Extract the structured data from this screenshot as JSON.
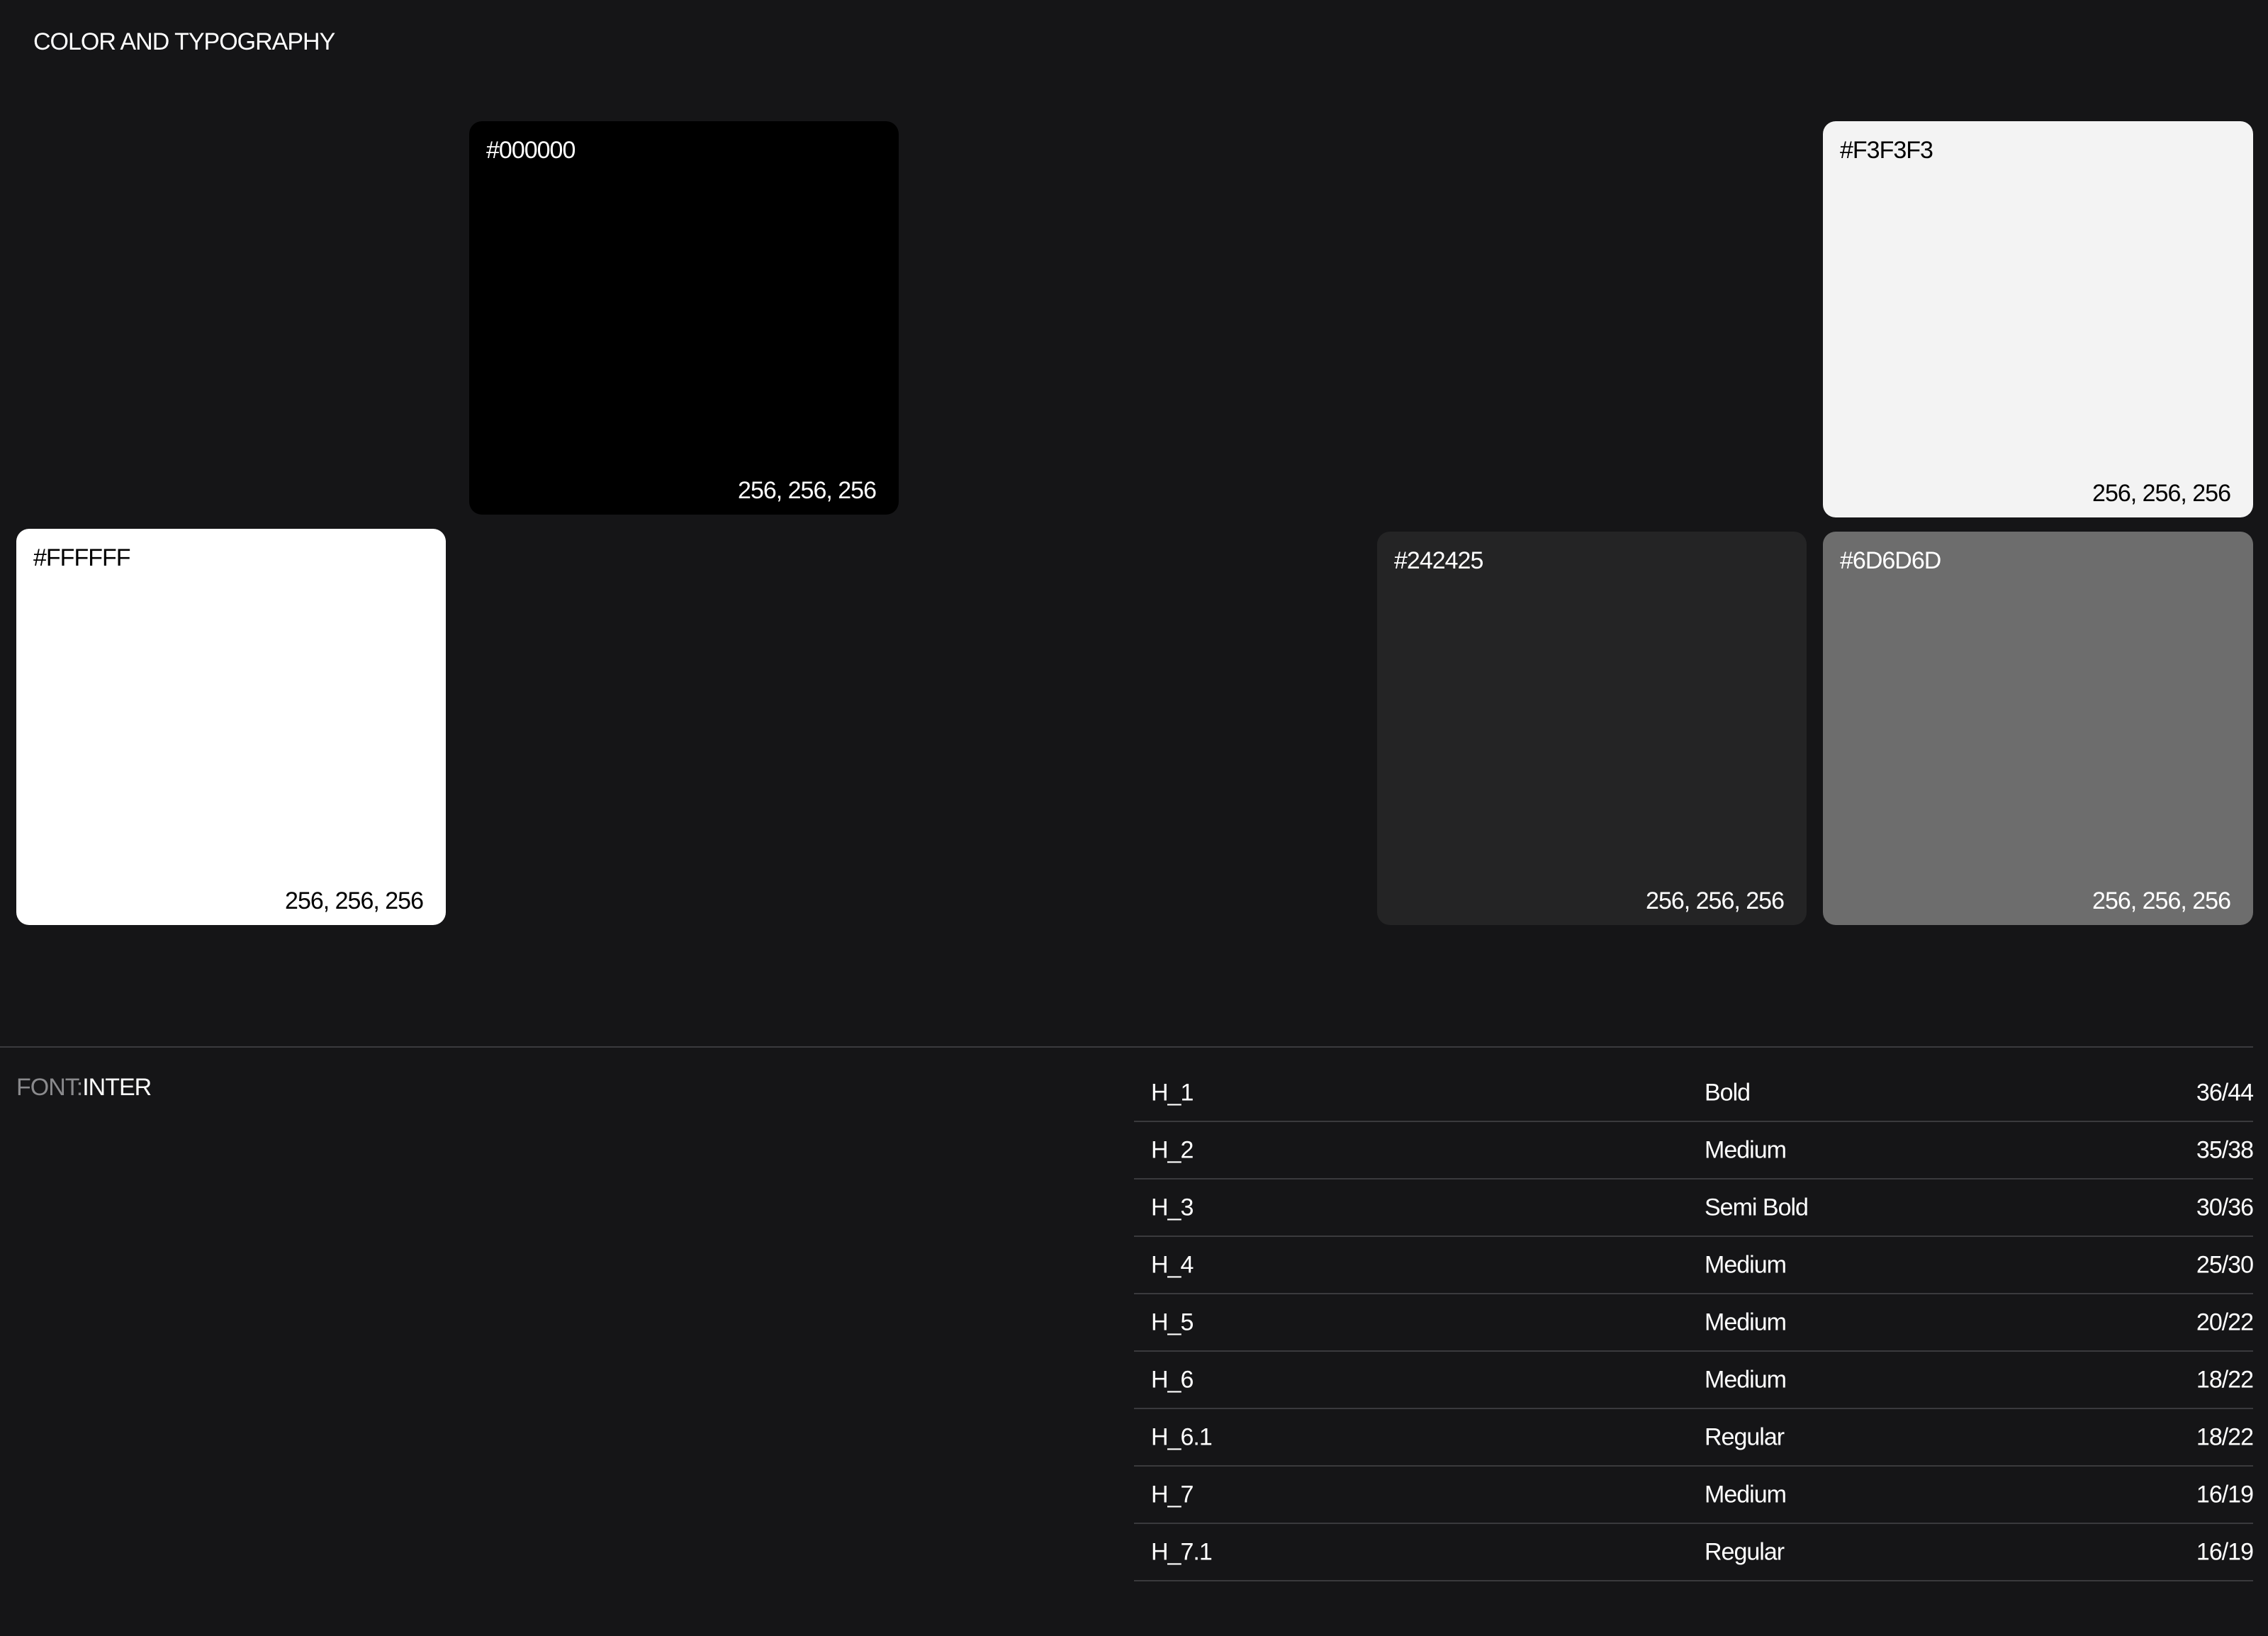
{
  "header": {
    "title": "COLOR AND TYPOGRAPHY"
  },
  "colors": [
    {
      "hex": "#000000",
      "rgb": "256, 256, 256",
      "fill": "#000000",
      "text_color": "#ffffff"
    },
    {
      "hex": "#F3F3F3",
      "rgb": "256, 256, 256",
      "fill": "#F3F3F3",
      "text_color": "#000000"
    },
    {
      "hex": "#FFFFFF",
      "rgb": "256, 256, 256",
      "fill": "#FFFFFF",
      "text_color": "#000000"
    },
    {
      "hex": "#242425",
      "rgb": "256, 256, 256",
      "fill": "#242425",
      "text_color": "#ffffff"
    },
    {
      "hex": "#6D6D6D",
      "rgb": "256, 256, 256",
      "fill": "#6D6D6D",
      "text_color": "#ffffff"
    }
  ],
  "font": {
    "prefix": "FONT:",
    "name": "INTER"
  },
  "type_scale": [
    {
      "name": "H_1",
      "weight": "Bold",
      "size": "36/44"
    },
    {
      "name": "H_2",
      "weight": "Medium",
      "size": "35/38"
    },
    {
      "name": "H_3",
      "weight": "Semi Bold",
      "size": "30/36"
    },
    {
      "name": "H_4",
      "weight": "Medium",
      "size": "25/30"
    },
    {
      "name": "H_5",
      "weight": "Medium",
      "size": "20/22"
    },
    {
      "name": "H_6",
      "weight": "Medium",
      "size": "18/22"
    },
    {
      "name": "H_6.1",
      "weight": "Regular",
      "size": "18/22"
    },
    {
      "name": "H_7",
      "weight": "Medium",
      "size": "16/19"
    },
    {
      "name": "H_7.1",
      "weight": "Regular",
      "size": "16/19"
    }
  ],
  "theme": {
    "background": "#151517",
    "divider": "#3a3a3d",
    "muted_text": "#8a8a8d"
  }
}
